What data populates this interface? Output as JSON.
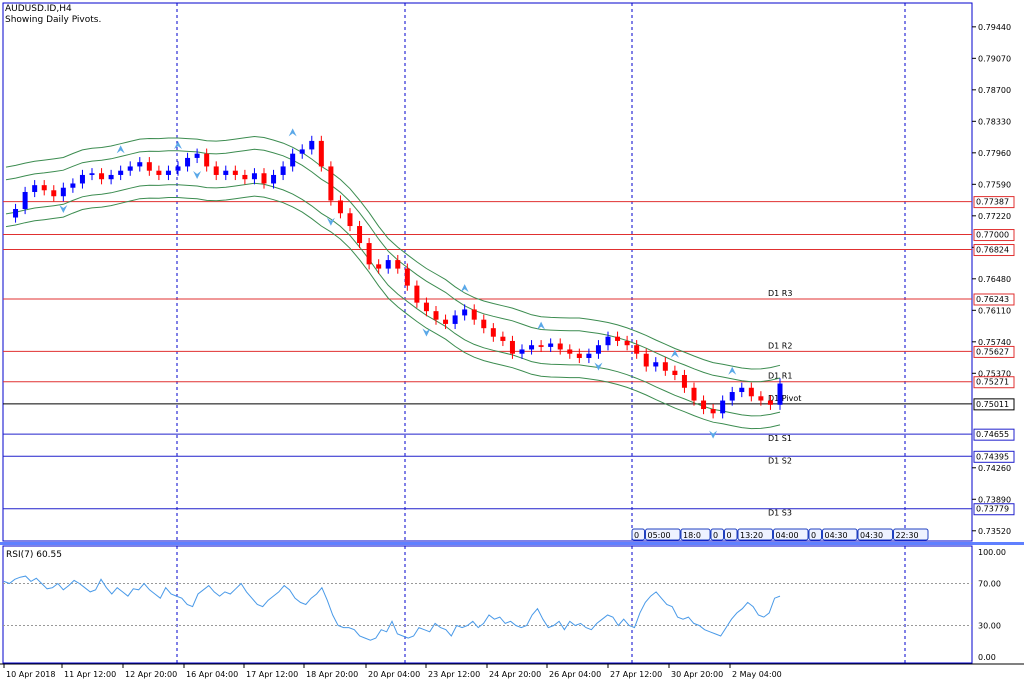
{
  "header": {
    "symbol_line": "AUDUSD.ID,H4",
    "pivot_line": "Showing Daily Pivots."
  },
  "colors": {
    "frame": "#0000cc",
    "grid_v": "#0000cc",
    "bull": "#0000ff",
    "bear": "#ff0000",
    "band": "#3c8c50",
    "resistance": "#e03030",
    "support": "#2020cc",
    "pivot": "#000000",
    "rsi": "#4a9ae8",
    "arrow": "#5aa8e8"
  },
  "chart_data": {
    "type": "candlestick",
    "symbol": "AUDUSD.ID",
    "timeframe": "H4",
    "price_axis": [
      "0.79440",
      "0.79070",
      "0.78700",
      "0.78330",
      "0.77960",
      "0.77590",
      "0.77220",
      "0.76850",
      "0.76480",
      "0.76110",
      "0.75740",
      "0.75370",
      "0.74260",
      "0.73890",
      "0.73520"
    ],
    "price_range": [
      0.734,
      0.7972
    ],
    "time_axis": [
      "10 Apr 2018",
      "11 Apr 12:00",
      "12 Apr 20:00",
      "16 Apr 04:00",
      "17 Apr 12:00",
      "18 Apr 20:00",
      "20 Apr 04:00",
      "23 Apr 12:00",
      "24 Apr 20:00",
      "26 Apr 04:00",
      "27 Apr 12:00",
      "30 Apr 20:00",
      "2 May 04:00"
    ],
    "pivot_levels": [
      {
        "label": "D1 R3",
        "value": "0.76243",
        "kind": "resistance"
      },
      {
        "label": "D1 R2",
        "value": "0.75627",
        "kind": "resistance"
      },
      {
        "label": "D1 R1",
        "value": "0.75271",
        "kind": "resistance"
      },
      {
        "label": "D1 Pivot",
        "value": "0.75011",
        "kind": "pivot"
      },
      {
        "label": "D1 S1",
        "value": "0.74655",
        "kind": "support"
      },
      {
        "label": "D1 S2",
        "value": "0.74395",
        "kind": "support"
      },
      {
        "label": "D1 S3",
        "value": "0.73779",
        "kind": "support"
      }
    ],
    "extra_levels": [
      {
        "value": "0.77387",
        "kind": "resistance"
      },
      {
        "value": "0.77000",
        "kind": "resistance"
      },
      {
        "value": "0.76824",
        "kind": "resistance"
      }
    ],
    "close_path": [
      0.772,
      0.773,
      0.775,
      0.7758,
      0.7752,
      0.7745,
      0.7755,
      0.776,
      0.777,
      0.7772,
      0.7765,
      0.777,
      0.7775,
      0.778,
      0.7785,
      0.7775,
      0.777,
      0.7775,
      0.778,
      0.779,
      0.7795,
      0.778,
      0.777,
      0.7775,
      0.777,
      0.7765,
      0.7772,
      0.776,
      0.777,
      0.778,
      0.7795,
      0.78,
      0.781,
      0.778,
      0.774,
      0.7725,
      0.771,
      0.769,
      0.7665,
      0.766,
      0.767,
      0.766,
      0.764,
      0.762,
      0.761,
      0.76,
      0.7595,
      0.7605,
      0.7612,
      0.76,
      0.759,
      0.758,
      0.7575,
      0.756,
      0.7565,
      0.757,
      0.7568,
      0.7572,
      0.7565,
      0.756,
      0.7555,
      0.756,
      0.757,
      0.758,
      0.7575,
      0.757,
      0.756,
      0.7545,
      0.755,
      0.754,
      0.7535,
      0.752,
      0.7505,
      0.7495,
      0.749,
      0.7505,
      0.7515,
      0.752,
      0.751,
      0.7505,
      0.75,
      0.7525
    ],
    "time_boxes": [
      "0",
      "05:00",
      "18:0",
      "0",
      "0",
      "13:20",
      "04:00",
      "0",
      "04:30",
      "04:30",
      "22:30"
    ],
    "rsi": {
      "label": "RSI(7) 60.55",
      "axis": [
        "100.00",
        "70.00",
        "30.00",
        "0.00"
      ],
      "levels": [
        70,
        30
      ],
      "values": [
        72,
        70,
        74,
        76,
        77,
        72,
        75,
        70,
        65,
        66,
        70,
        64,
        68,
        73,
        70,
        66,
        62,
        64,
        74,
        66,
        60,
        66,
        62,
        58,
        65,
        64,
        70,
        64,
        60,
        56,
        66,
        60,
        58,
        56,
        50,
        48,
        60,
        64,
        68,
        62,
        58,
        62,
        60,
        65,
        70,
        62,
        56,
        50,
        48,
        54,
        58,
        62,
        68,
        64,
        56,
        52,
        50,
        56,
        60,
        66,
        54,
        40,
        30,
        28,
        28,
        26,
        20,
        18,
        16,
        18,
        26,
        24,
        34,
        22,
        20,
        18,
        20,
        28,
        26,
        24,
        32,
        28,
        26,
        20,
        30,
        28,
        30,
        34,
        28,
        32,
        40,
        36,
        38,
        32,
        34,
        30,
        28,
        30,
        40,
        46,
        36,
        28,
        30,
        34,
        26,
        34,
        30,
        32,
        28,
        26,
        32,
        36,
        40,
        38,
        30,
        36,
        30,
        28,
        42,
        52,
        58,
        62,
        56,
        50,
        48,
        38,
        36,
        38,
        32,
        30,
        26,
        24,
        22,
        20,
        28,
        36,
        42,
        46,
        52,
        48,
        40,
        38,
        42,
        56,
        58
      ]
    }
  }
}
